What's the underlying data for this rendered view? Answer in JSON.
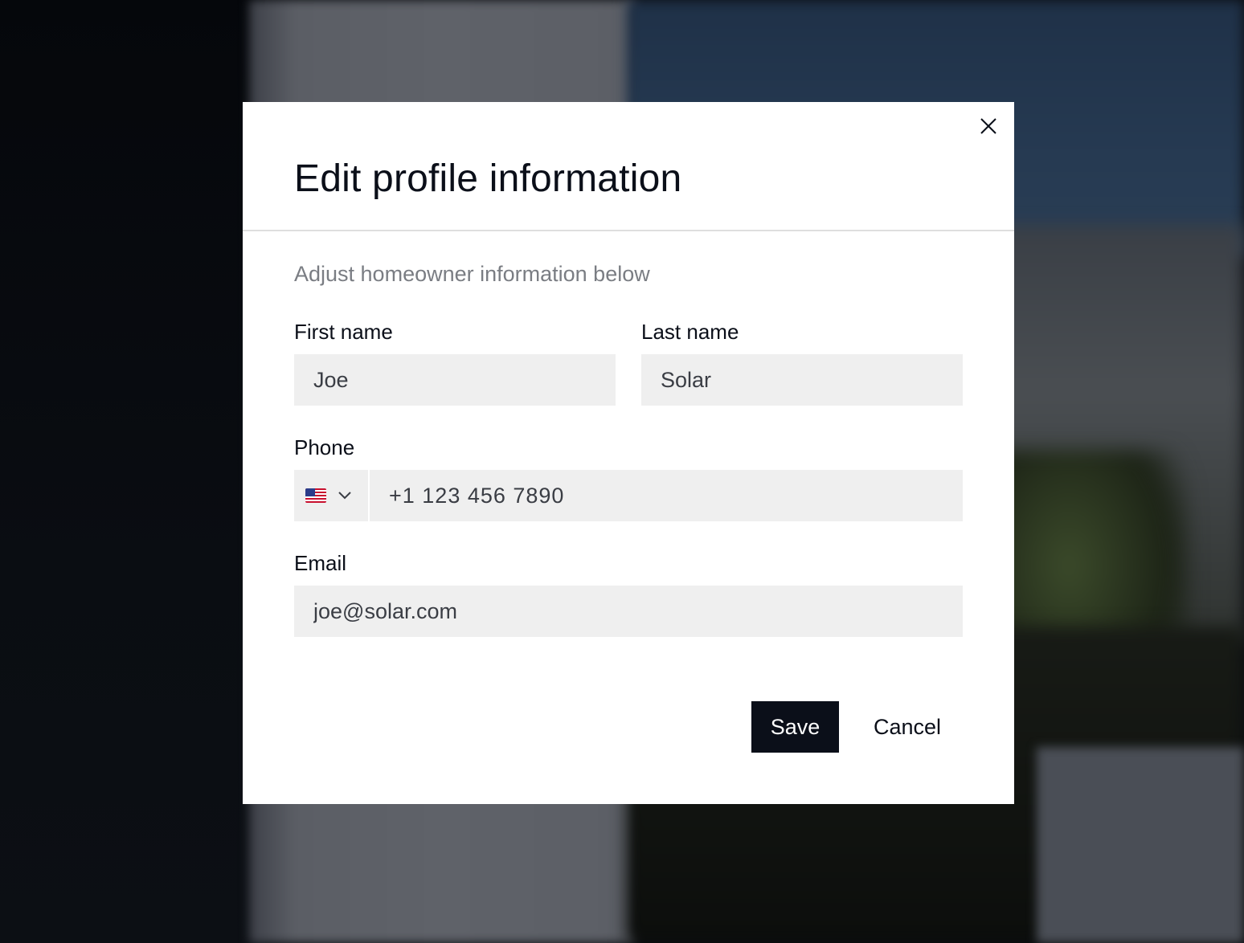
{
  "modal": {
    "title": "Edit profile information",
    "subtitle": "Adjust homeowner information below",
    "close_icon": "close-icon"
  },
  "form": {
    "first_name": {
      "label": "First name",
      "value": "Joe"
    },
    "last_name": {
      "label": "Last name",
      "value": "Solar"
    },
    "phone": {
      "label": "Phone",
      "country_flag_icon": "us-flag-icon",
      "dropdown_icon": "chevron-down-icon",
      "value": "+1 123 456 7890"
    },
    "email": {
      "label": "Email",
      "value": "joe@solar.com"
    }
  },
  "actions": {
    "save_label": "Save",
    "cancel_label": "Cancel"
  },
  "colors": {
    "primary": "#0b0f19",
    "input_bg": "#efefef",
    "subtitle": "#7a7d83",
    "divider": "#dedede"
  }
}
